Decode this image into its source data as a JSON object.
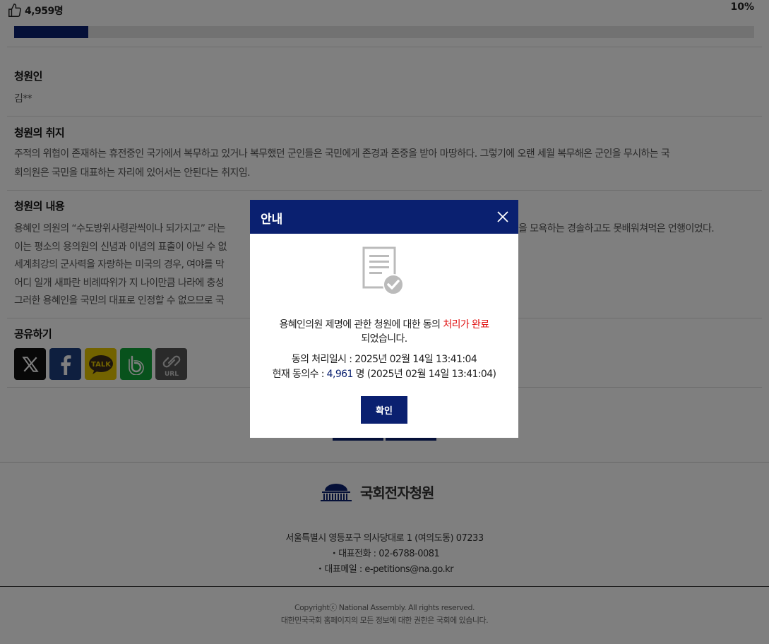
{
  "vote": {
    "count": "4,959명",
    "percent_label": "10%",
    "progress": 0.1
  },
  "sections": {
    "petitioner": {
      "title": "청원인",
      "value": "김**"
    },
    "purpose": {
      "title": "청원의 취지",
      "lines": [
        "주적의 위협이 존재하는 휴전중인 국가에서 복무하고 있거나 복무했던 군인들은 국민에게 존경과 존중을 받아 마땅하다. 그렇기에 오랜 세월 복무해온 군인을 무시하는 국",
        "회의원은 국민을 대표하는 자리에 있어서는 안된다는 취지임."
      ]
    },
    "content": {
      "title": "청원의 내용",
      "lines": [
        "용혜인 의원의 “수도방위사령관씩이나 되가지고” 라는",
        "이는 평소의 용의원의 신념과 이념의 표출이 아닐 수 없",
        "세계최강의 군사력을 자랑하는 미국의 경우, 여야를 막",
        "어디 일개 새파란 비례따위가 지 나이만큼 나라에 충성",
        "그러한 용혜인을 국민의 대표로 인정할 수 없으므로 국"
      ],
      "line1_tail": "을 모욕하는 경솔하고도 못배워쳐먹은 언행이었다."
    },
    "share": {
      "title": "공유하기",
      "buttons": [
        {
          "name": "x",
          "label": "X",
          "color": "#111111"
        },
        {
          "name": "facebook",
          "label": "f",
          "color": "#1c3f7e"
        },
        {
          "name": "kakaotalk",
          "label": "TALK",
          "color": "#e6c700"
        },
        {
          "name": "band",
          "label": "b",
          "color": "#10a538"
        },
        {
          "name": "url",
          "label": "URL",
          "color": "#555555"
        }
      ]
    }
  },
  "footer": {
    "logo_text": "국회전자청원",
    "address": "서울특별시 영등포구 의사당대로 1 (여의도동) 07233",
    "phone": "・대표전화 : 02-6788-0081",
    "email": "・대표메일 : e-petitions@na.go.kr",
    "copyright": "Copyrightⓒ National Assembly. All rights reserved.",
    "rights": "대한민국국회 홈페이지의 모든 정보에 대한 권한은 국회에 있습니다."
  },
  "modal": {
    "title": "안내",
    "message_part1": "용혜인의원 제명에 관한 청원에 대한 동의 ",
    "message_highlight": "처리가 완료",
    "message_part2": "되었습니다.",
    "processed_label": "동의 처리일시 : 2025년 02월 14일 13:41:04",
    "current_label": "현재 동의수 : ",
    "current_count": "4,961",
    "current_tail": " 명 (2025년 02월 14일 13:41:04)",
    "confirm_label": "확인"
  },
  "colors": {
    "brand_navy": "#0a2070",
    "highlight_red": "#e01010"
  }
}
